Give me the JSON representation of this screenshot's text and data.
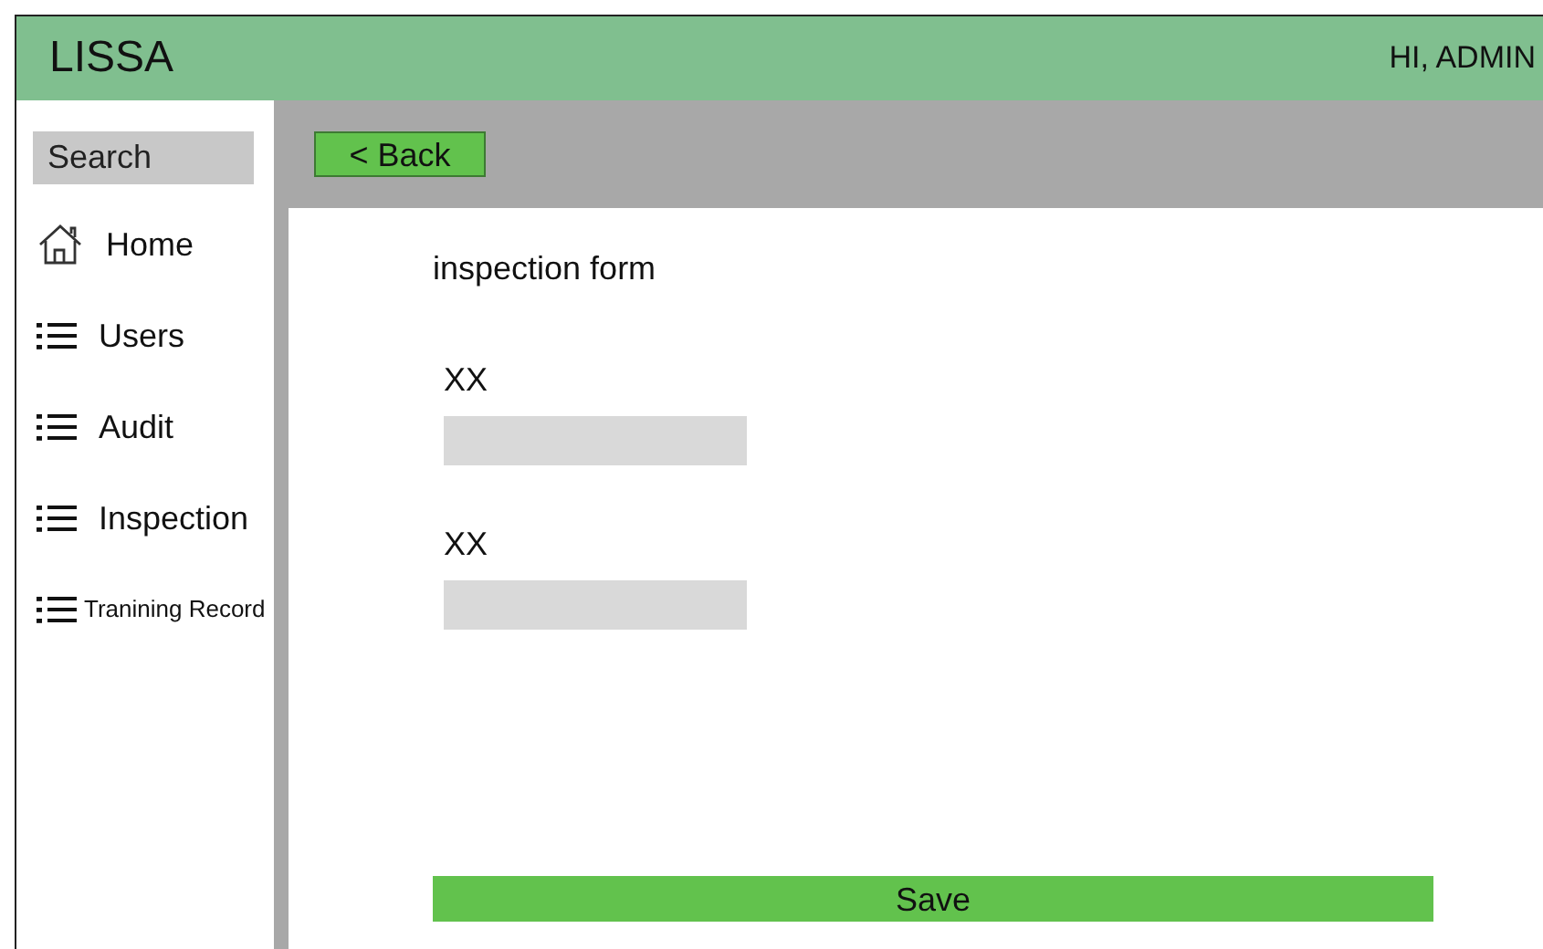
{
  "header": {
    "title": "LISSA",
    "greeting": "HI, ADMIN"
  },
  "sidebar": {
    "search": {
      "placeholder": "Search"
    },
    "items": [
      {
        "label": "Home",
        "kind": "home"
      },
      {
        "label": "Users",
        "kind": "list"
      },
      {
        "label": "Audit",
        "kind": "list"
      },
      {
        "label": "Inspection",
        "kind": "list"
      },
      {
        "label": "Tranining Record",
        "kind": "compact"
      }
    ]
  },
  "toolbar": {
    "back_button": "< Back"
  },
  "form": {
    "title": "inspection form",
    "fields": [
      {
        "label": "XX"
      },
      {
        "label": "XX"
      }
    ],
    "save_button": "Save"
  }
}
